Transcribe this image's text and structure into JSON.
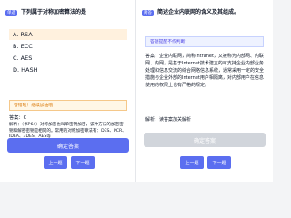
{
  "left": {
    "badge": "单选",
    "question": "下列属于对称加密算法的是",
    "options": [
      {
        "label": "A. RSA"
      },
      {
        "label": "B. ECC"
      },
      {
        "label": "C. AES"
      },
      {
        "label": "D. HASH"
      }
    ],
    "selected_index": 0,
    "wrong_tip": "答错啦！继续加油哦",
    "answer": "答案：C",
    "analysis": "解析：（书P64）对称加密也叫单密钥加密，该种方法的加密密钥和解密密钥是相同的。常用的对称加密算法有：DES、PCR、IDEA、3DES、AES等",
    "confirm": "确定答案",
    "prev": "上一题",
    "next": "下一题"
  },
  "right": {
    "badge": "简答",
    "question": "简述企业内联网的含义及其组成。",
    "tip": "答题提醒不作判断",
    "answer": "答案：企业内联网，简称Intranet，又被称为内部网、内联网、内网，是基于Internet技术建立的可支持企业内部业务处理和信息交流的综合网络信息系统，通常采用一定的安全措施与企业外部的Internet用户相隔离，对内部用户在信息使用的权限上也有严格的规定。",
    "analysis": "解析：读答案加关解析",
    "confirm": "确定答案",
    "prev": "上一题",
    "next": "下一题"
  },
  "colors": {
    "accent": "#5b6ef0",
    "selected_bg": "#fff1de",
    "warning": "#d97706"
  }
}
